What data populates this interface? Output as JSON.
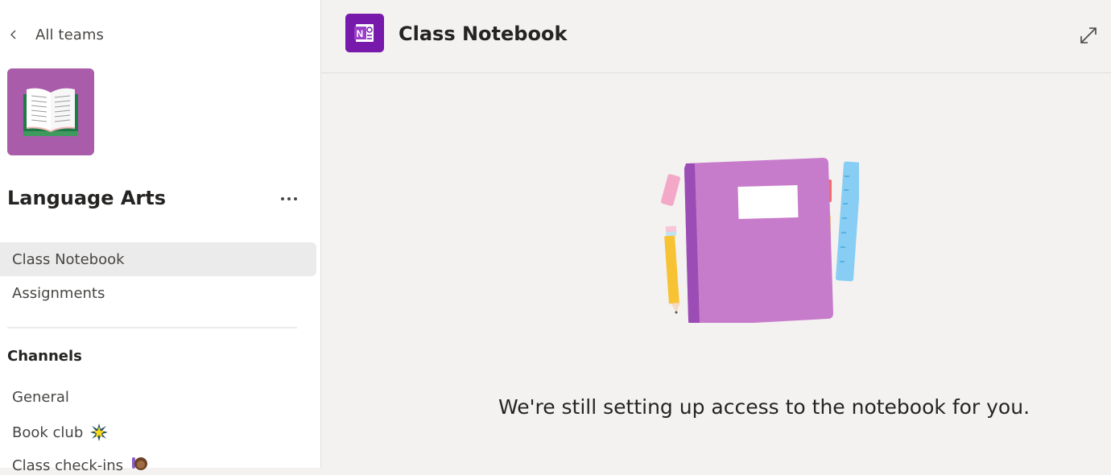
{
  "sidebar": {
    "back_label": "All teams",
    "team_name": "Language Arts",
    "team_avatar": {
      "icon": "open-book-icon",
      "color": "#a95ca9"
    },
    "more_options_icon": "ellipsis-icon",
    "nav_items": [
      {
        "label": "Class Notebook",
        "active": true
      },
      {
        "label": "Assignments",
        "active": false
      }
    ],
    "channels_heading": "Channels",
    "channels": [
      {
        "label": "General",
        "emoji": null
      },
      {
        "label": "Book club",
        "emoji": "sparkle-star-icon"
      },
      {
        "label": "Class check-ins",
        "emoji": "raising-hand-icon"
      }
    ]
  },
  "header": {
    "app_icon": "onenote-icon",
    "app_color": "#7719aa",
    "title": "Class Notebook",
    "expand_icon": "expand-icon"
  },
  "main": {
    "illustration": "notebook-illustration",
    "message": "We're still setting up access to the notebook for you."
  }
}
